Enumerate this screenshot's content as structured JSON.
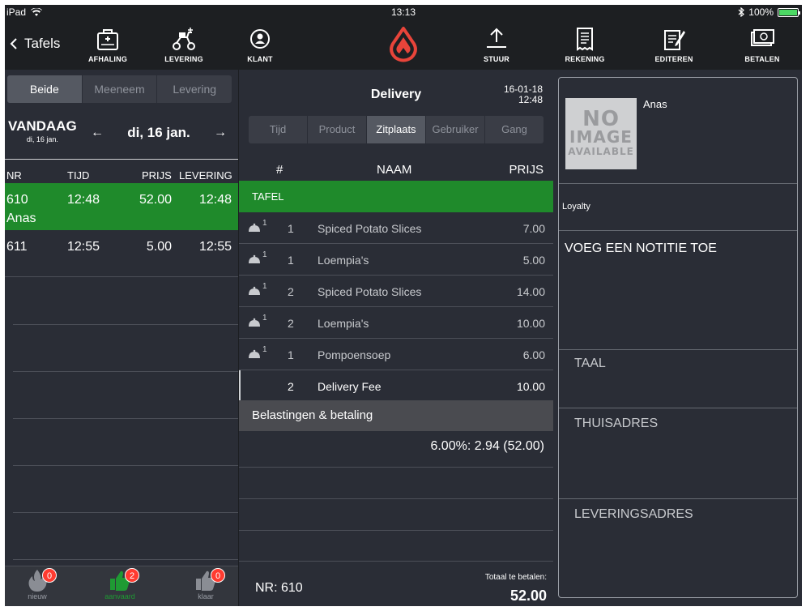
{
  "status": {
    "device": "iPad",
    "time": "13:13",
    "battery": "100%"
  },
  "toolbar": {
    "back_label": "Tafels",
    "buttons": [
      {
        "label": "AFHALING",
        "icon": "takeaway-bag-icon"
      },
      {
        "label": "LEVERING",
        "icon": "scooter-icon"
      },
      {
        "label": "KLANT",
        "icon": "customer-icon"
      },
      {
        "label": "STUUR",
        "icon": "upload-icon"
      },
      {
        "label": "REKENING",
        "icon": "receipt-icon"
      },
      {
        "label": "EDITEREN",
        "icon": "edit-icon"
      },
      {
        "label": "BETALEN",
        "icon": "cash-icon"
      }
    ],
    "accent": "#e8443a"
  },
  "left": {
    "segments": [
      "Beide",
      "Meeneem",
      "Levering"
    ],
    "active_segment": "Beide",
    "today_label": "VANDAAG",
    "today_sub": "di, 16 jan.",
    "date": "di, 16 jan.",
    "columns": [
      "NR",
      "TIJD",
      "PRIJS",
      "LEVERING"
    ],
    "orders": [
      {
        "nr": "610",
        "tijd": "12:48",
        "prijs": "52.00",
        "levering": "12:48",
        "name": "Anas",
        "selected": true
      },
      {
        "nr": "611",
        "tijd": "12:55",
        "prijs": "5.00",
        "levering": "12:55",
        "name": "",
        "selected": false
      }
    ],
    "tabs": [
      {
        "label": "nieuw",
        "badge": "0",
        "icon": "fire-icon"
      },
      {
        "label": "aanvaard",
        "badge": "2",
        "icon": "thumbs-up-icon"
      },
      {
        "label": "klaar",
        "badge": "0",
        "icon": "thumbs-up-icon"
      }
    ]
  },
  "center": {
    "title": "Delivery",
    "date": "16-01-18",
    "time": "12:48",
    "sort_tabs": [
      "Tijd",
      "Product",
      "Zitplaats",
      "Gebruiker",
      "Gang"
    ],
    "active_sort": "Zitplaats",
    "columns": {
      "hash": "#",
      "name": "NAAM",
      "price": "PRIJS"
    },
    "group_label": "TAFEL",
    "items": [
      {
        "course": "1",
        "qty": "1",
        "name": "Spiced Potato Slices",
        "price": "7.00"
      },
      {
        "course": "1",
        "qty": "1",
        "name": "Loempia's",
        "price": "5.00"
      },
      {
        "course": "1",
        "qty": "2",
        "name": "Spiced Potato Slices",
        "price": "14.00"
      },
      {
        "course": "1",
        "qty": "2",
        "name": "Loempia's",
        "price": "10.00"
      },
      {
        "course": "1",
        "qty": "1",
        "name": "Pompoensoep",
        "price": "6.00"
      }
    ],
    "fee": {
      "qty": "2",
      "name": "Delivery Fee",
      "price": "10.00"
    },
    "tax_header": "Belastingen & betaling",
    "tax_line": "6.00%: 2.94 (52.00)",
    "order_nr": "NR: 610",
    "total_label": "Totaal te betalen:",
    "total": "52.00"
  },
  "right": {
    "no_image": [
      "NO",
      "IMAGE",
      "AVAILABLE"
    ],
    "customer_name": "Anas",
    "loyalty": "Loyalty",
    "note": "VOEG EEN NOTITIE TOE",
    "language": "TAAL",
    "home_address": "THUISADRES",
    "delivery_address": "LEVERINGSADRES"
  },
  "colors": {
    "green": "#1f8a2b",
    "badge": "#ff3b30",
    "background": "#2a2d36"
  }
}
